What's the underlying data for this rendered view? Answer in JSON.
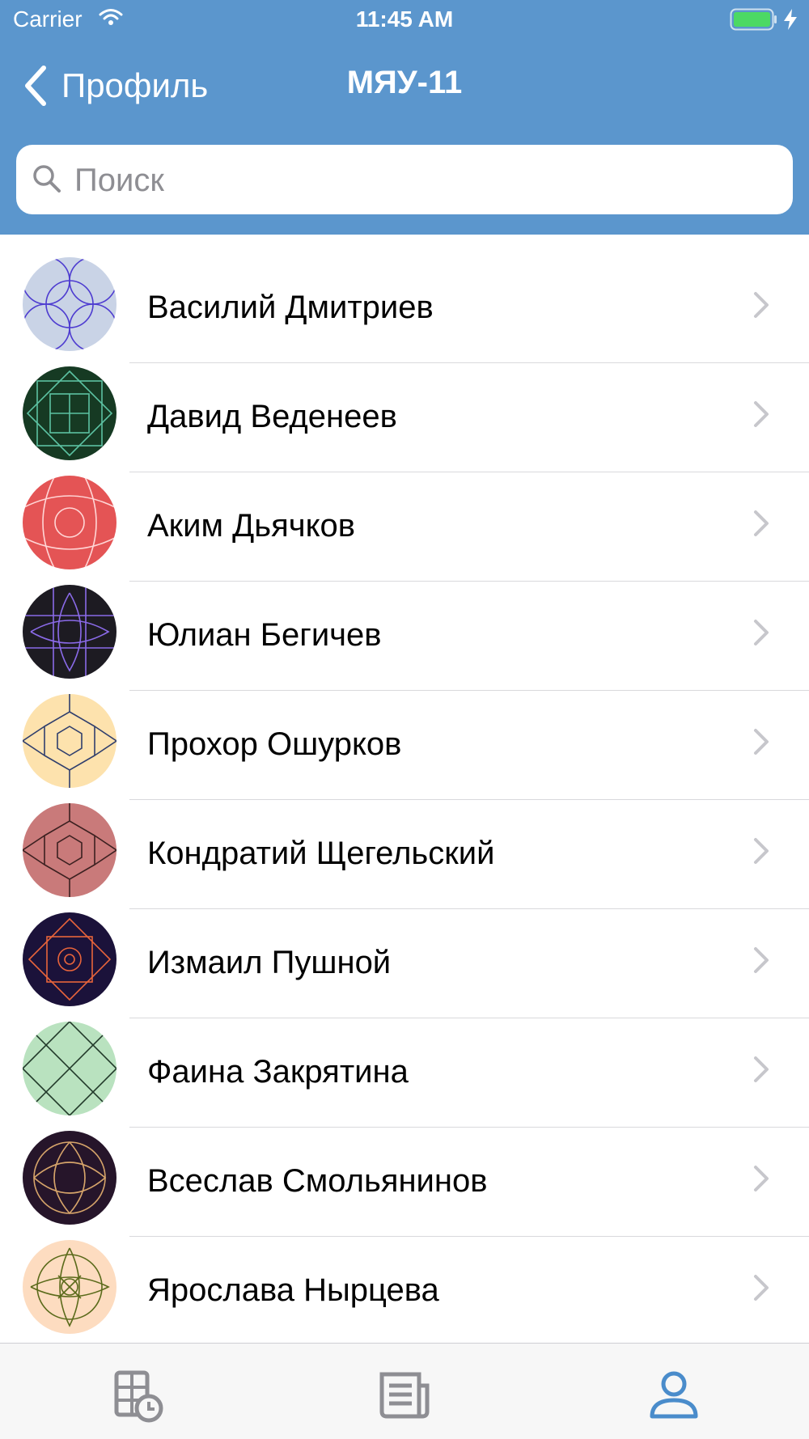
{
  "status_bar": {
    "carrier": "Carrier",
    "time": "11:45 AM"
  },
  "nav": {
    "back_label": "Профиль",
    "title": "МЯУ-11"
  },
  "search": {
    "placeholder": "Поиск",
    "value": ""
  },
  "colors": {
    "accent": "#5b96cd",
    "tab_active": "#4a8ccb",
    "tab_inactive": "#8e8e93"
  },
  "members": [
    {
      "name": "Василий Дмитриев",
      "avatar_bg": "#c9d3e6",
      "avatar_fg": "#4d3bd0",
      "pattern": "circles"
    },
    {
      "name": "Давид Веденеев",
      "avatar_bg": "#163a23",
      "avatar_fg": "#5cc2a2",
      "pattern": "squares"
    },
    {
      "name": "Аким Дьячков",
      "avatar_bg": "#e45455",
      "avatar_fg": "#ffd6d6",
      "pattern": "waves"
    },
    {
      "name": "Юлиан Бегичев",
      "avatar_bg": "#1d1b22",
      "avatar_fg": "#8a6ae8",
      "pattern": "grid"
    },
    {
      "name": "Прохор Ошурков",
      "avatar_bg": "#fde2ad",
      "avatar_fg": "#2f3e6d",
      "pattern": "hexes"
    },
    {
      "name": "Кондратий Щегельский",
      "avatar_bg": "#c97a7a",
      "avatar_fg": "#3b2020",
      "pattern": "hexes"
    },
    {
      "name": "Измаил Пушной",
      "avatar_bg": "#1b123a",
      "avatar_fg": "#e8643b",
      "pattern": "diamond"
    },
    {
      "name": "Фаина Закрятина",
      "avatar_bg": "#b9e2bf",
      "avatar_fg": "#223a2a",
      "pattern": "cross"
    },
    {
      "name": "Всеслав Смольянинов",
      "avatar_bg": "#26152a",
      "avatar_fg": "#d6a46a",
      "pattern": "knot"
    },
    {
      "name": "Ярослава Нырцева",
      "avatar_bg": "#fddcc0",
      "avatar_fg": "#5a6a1a",
      "pattern": "flower"
    }
  ],
  "tabs": [
    {
      "icon": "schedule-icon",
      "active": false
    },
    {
      "icon": "news-icon",
      "active": false
    },
    {
      "icon": "profile-icon",
      "active": true
    }
  ]
}
